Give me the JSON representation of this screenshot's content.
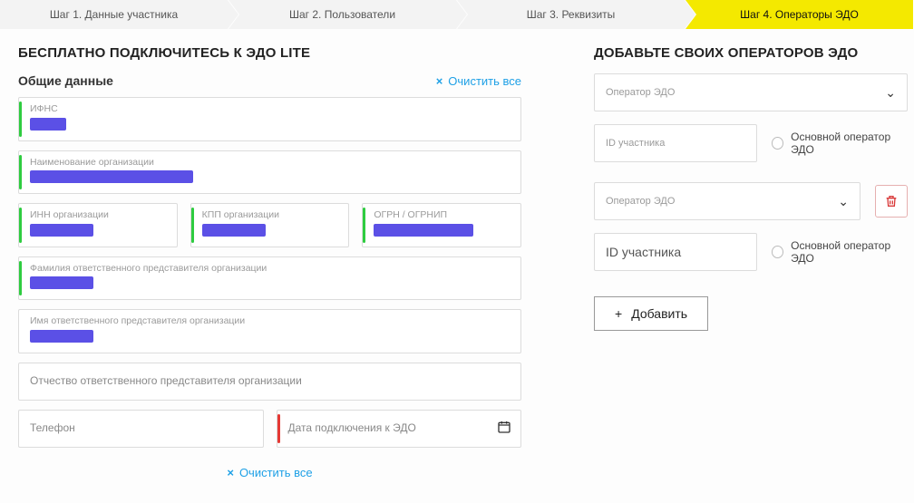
{
  "stepper": {
    "steps": [
      "Шаг 1. Данные участника",
      "Шаг 2. Пользователи",
      "Шаг 3. Реквизиты",
      "Шаг 4. Операторы ЭДО"
    ],
    "activeIndex": 3
  },
  "left": {
    "heading": "БЕСПЛАТНО ПОДКЛЮЧИТЕСЬ К ЭДО LITE",
    "sectionTitle": "Общие данные",
    "clearAll": "Очистить все",
    "fields": {
      "ifns": {
        "label": "ИФНС"
      },
      "orgName": {
        "label": "Наименование организации"
      },
      "inn": {
        "label": "ИНН организации"
      },
      "kpp": {
        "label": "КПП организации"
      },
      "ogrn": {
        "label": "ОГРН / ОГРНИП"
      },
      "respSurname": {
        "label": "Фамилия ответственного представителя организации"
      },
      "respName": {
        "label": "Имя ответственного представителя организации"
      },
      "respPatronymic": {
        "label": "Отчество ответственного представителя организации"
      },
      "phone": {
        "label": "Телефон"
      },
      "connDate": {
        "label": "Дата подключения к ЭДО"
      }
    }
  },
  "right": {
    "heading": "ДОБАВЬТЕ СВОИХ ОПЕРАТОРОВ ЭДО",
    "operatorLabel": "Оператор ЭДО",
    "participantId": "ID участника",
    "mainOperatorLabel": "Основной оператор ЭДО",
    "addButton": "Добавить"
  },
  "bottom": {
    "clearAll": "Очистить все"
  }
}
